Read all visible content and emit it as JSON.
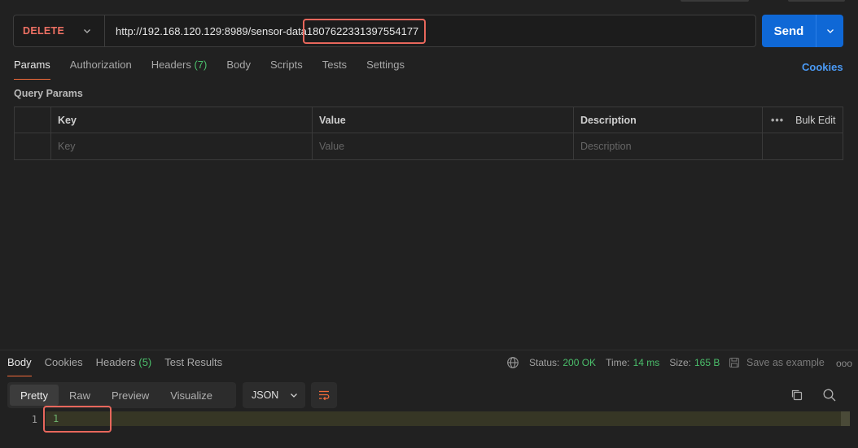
{
  "request": {
    "method": "DELETE",
    "url_base": "http://192.168.120.129:8989/sensor-data",
    "url_id": "1807622331397554177",
    "send_label": "Send"
  },
  "request_tabs": [
    {
      "label": "Params",
      "active": true
    },
    {
      "label": "Authorization"
    },
    {
      "label": "Headers",
      "count": "(7)"
    },
    {
      "label": "Body"
    },
    {
      "label": "Scripts"
    },
    {
      "label": "Tests"
    },
    {
      "label": "Settings"
    }
  ],
  "cookies_link": "Cookies",
  "query_params": {
    "title": "Query Params",
    "headers": {
      "key": "Key",
      "value": "Value",
      "description": "Description",
      "bulk_edit": "Bulk Edit"
    },
    "placeholders": {
      "key": "Key",
      "value": "Value",
      "description": "Description"
    }
  },
  "response_tabs": [
    {
      "label": "Body",
      "active": true
    },
    {
      "label": "Cookies"
    },
    {
      "label": "Headers",
      "count": "(5)"
    },
    {
      "label": "Test Results"
    }
  ],
  "response_status": {
    "status_label": "Status:",
    "status_value": "200 OK",
    "time_label": "Time:",
    "time_value": "14 ms",
    "size_label": "Size:",
    "size_value": "165 B",
    "save_example": "Save as example"
  },
  "format_buttons": [
    {
      "label": "Pretty",
      "active": true
    },
    {
      "label": "Raw"
    },
    {
      "label": "Preview"
    },
    {
      "label": "Visualize"
    }
  ],
  "format_select": "JSON",
  "response_body": {
    "line_number": "1",
    "value": "1"
  },
  "colors": {
    "accent_orange": "#f26b3a",
    "method_delete": "#f07164",
    "send_blue": "#0f68d6",
    "success_green": "#4bbf6b",
    "link_blue": "#4a9af5",
    "highlight_red": "#e8675c"
  },
  "icons": [
    "chevron-down-icon",
    "globe-icon",
    "save-icon",
    "more-icon",
    "wrap-lines-icon",
    "copy-icon",
    "search-icon"
  ]
}
